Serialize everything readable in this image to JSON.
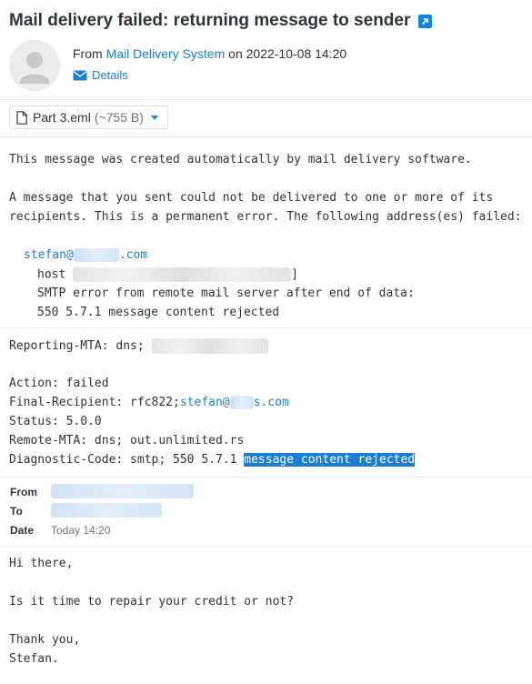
{
  "message": {
    "subject": "Mail delivery failed: returning message to sender",
    "from_prefix": "From",
    "sender_name": "Mail Delivery System",
    "date_prefix": "on",
    "date": "2022-10-08 14:20",
    "details_label": "Details"
  },
  "attachment": {
    "name": "Part 3.eml",
    "size": "(~755 B)"
  },
  "body": {
    "line1": "This message was created automatically by mail delivery software.",
    "line2": "A message that you sent could not be delivered to one or more of its",
    "line3": "recipients. This is a permanent error. The following address(es) failed:",
    "addr_user": "stefan@",
    "addr_tld": ".com",
    "host_label": "host",
    "host_close": "]",
    "smtp_line": "SMTP error from remote mail server after end of data:",
    "code_line": "550 5.7.1 message content rejected"
  },
  "report": {
    "reporting_mta": "Reporting-MTA: dns;",
    "action": "Action: failed",
    "final_recipient_label": "Final-Recipient: rfc822;",
    "final_recipient_user": "stefan@",
    "final_recipient_mid": "s",
    "final_recipient_tld": ".com",
    "status": "Status: 5.0.0",
    "remote_mta": "Remote-MTA: dns; out.unlimited.rs",
    "diag_prefix": "Diagnostic-Code: smtp; 550 5.7.1",
    "diag_highlight": "message content rejected"
  },
  "original_headers": {
    "from_label": "From",
    "to_label": "To",
    "date_label": "Date",
    "date_value": "Today 14:20"
  },
  "original_body": {
    "greeting": "Hi there,",
    "question": "Is it time to repair your credit or not?",
    "thanks": "Thank you,",
    "signature": "Stefan."
  },
  "colors": {
    "link": "#1a7fd4",
    "highlight": "#1a7fd4",
    "text": "#2c363a"
  },
  "icons": {
    "external": "external-link-icon",
    "avatar": "person-icon",
    "details": "envelope-icon",
    "attachment": "file-icon",
    "dropdown": "caret-down-icon"
  }
}
